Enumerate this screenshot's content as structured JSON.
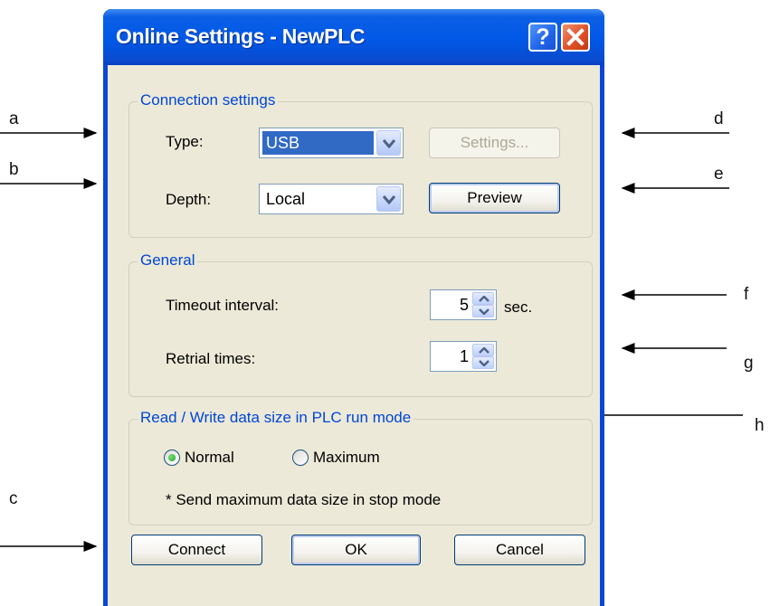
{
  "dialog": {
    "title": "Online Settings - NewPLC",
    "help_glyph": "?",
    "close_icon": "close-icon"
  },
  "connection": {
    "group_label": "Connection settings",
    "type_label": "Type:",
    "type_value": "USB",
    "depth_label": "Depth:",
    "depth_value": "Local",
    "settings_button": "Settings...",
    "preview_button": "Preview"
  },
  "general": {
    "group_label": "General",
    "timeout_label": "Timeout interval:",
    "timeout_value": "5",
    "timeout_unit": "sec.",
    "retrial_label": "Retrial times:",
    "retrial_value": "1"
  },
  "rw": {
    "group_label": "Read / Write data size in PLC run mode",
    "normal_label": "Normal",
    "maximum_label": "Maximum",
    "selected": "Normal",
    "note": "* Send maximum data size in stop mode"
  },
  "buttons": {
    "connect": "Connect",
    "ok": "OK",
    "cancel": "Cancel"
  },
  "annotations": {
    "a": "a",
    "b": "b",
    "c": "c",
    "d": "d",
    "e": "e",
    "f": "f",
    "g": "g",
    "h": "h"
  },
  "colors": {
    "titlebar": "#0058e6",
    "dialog_bg": "#ece9d8",
    "group_label": "#0046d5",
    "close_button": "#e0512a",
    "selection": "#316ac5"
  }
}
